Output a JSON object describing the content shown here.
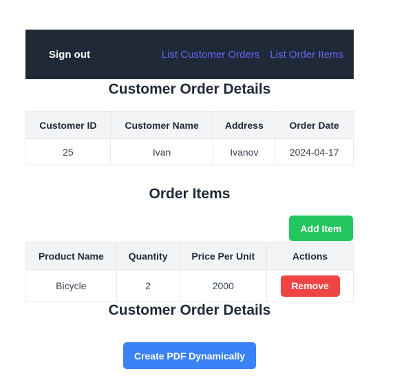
{
  "nav": {
    "signout_label": "Sign out",
    "links": [
      "List Customer Orders",
      "List Order Items"
    ]
  },
  "customer_section": {
    "title": "Customer Order Details",
    "headers": [
      "Customer ID",
      "Customer Name",
      "Address",
      "Order Date"
    ],
    "rows": [
      [
        "25",
        "Ivan",
        "Ivanov",
        "2024-04-17"
      ]
    ]
  },
  "items_section": {
    "title": "Order Items",
    "add_button_label": "Add Item",
    "headers": [
      "Product Name",
      "Quantity",
      "Price Per Unit",
      "Actions"
    ],
    "rows": [
      {
        "product": "Bicycle",
        "quantity": "2",
        "price": "2000",
        "action_label": "Remove"
      }
    ]
  },
  "footer_section": {
    "title": "Customer Order Details",
    "pdf_button_label": "Create PDF Dynamically"
  },
  "colors": {
    "navbar_bg": "#1f2937",
    "link": "#6366f1",
    "add_button": "#22c55e",
    "remove_button": "#ef4444",
    "pdf_button": "#3b82f6"
  }
}
